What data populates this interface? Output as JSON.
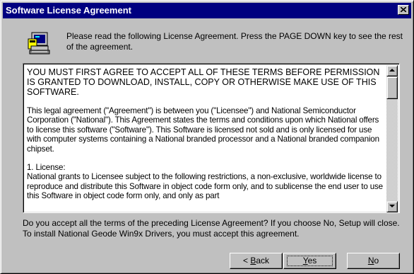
{
  "window": {
    "title": "Software License Agreement",
    "close_icon": "close-icon"
  },
  "header": {
    "icon": "setup-computer-icon",
    "instructions": "Please read the following License Agreement.  Press the PAGE DOWN key to see the rest of the agreement."
  },
  "license_text": {
    "paragraphs": [
      "YOU MUST FIRST AGREE TO ACCEPT ALL OF THESE TERMS BEFORE PERMISSION IS GRANTED TO DOWNLOAD, INSTALL, COPY OR OTHERWISE MAKE USE OF THIS SOFTWARE.",
      "This legal agreement (\"Agreement\") is between you (\"Licensee\") and National Semiconductor Corporation (\"National\"). This Agreement states the terms and conditions upon which National offers to license this software (\"Software\").  This Software is licensed not sold and is only licensed for use with computer systems containing a National branded processor and a National branded companion chipset.",
      "1.  License:",
      "National grants to Licensee subject to the following restrictions, a non-exclusive, worldwide license to reproduce and distribute this Software in object code form only, and to sublicense the end user to use this Software in object code form only, and only as part"
    ],
    "scroll_up_icon": "arrow-up-icon",
    "scroll_down_icon": "arrow-down-icon"
  },
  "footer": {
    "question": "Do you accept all the terms of the preceding License Agreement?  If you choose No,  Setup will close.  To install National Geode Win9x Drivers, you must accept this agreement."
  },
  "buttons": {
    "back_prefix": "< ",
    "back_mnemonic": "B",
    "back_rest": "ack",
    "yes_mnemonic": "Y",
    "yes_rest": "es",
    "no_mnemonic": "N",
    "no_rest": "o"
  },
  "colors": {
    "titlebar": "#000080",
    "dialog_face": "#c0c0c0"
  }
}
